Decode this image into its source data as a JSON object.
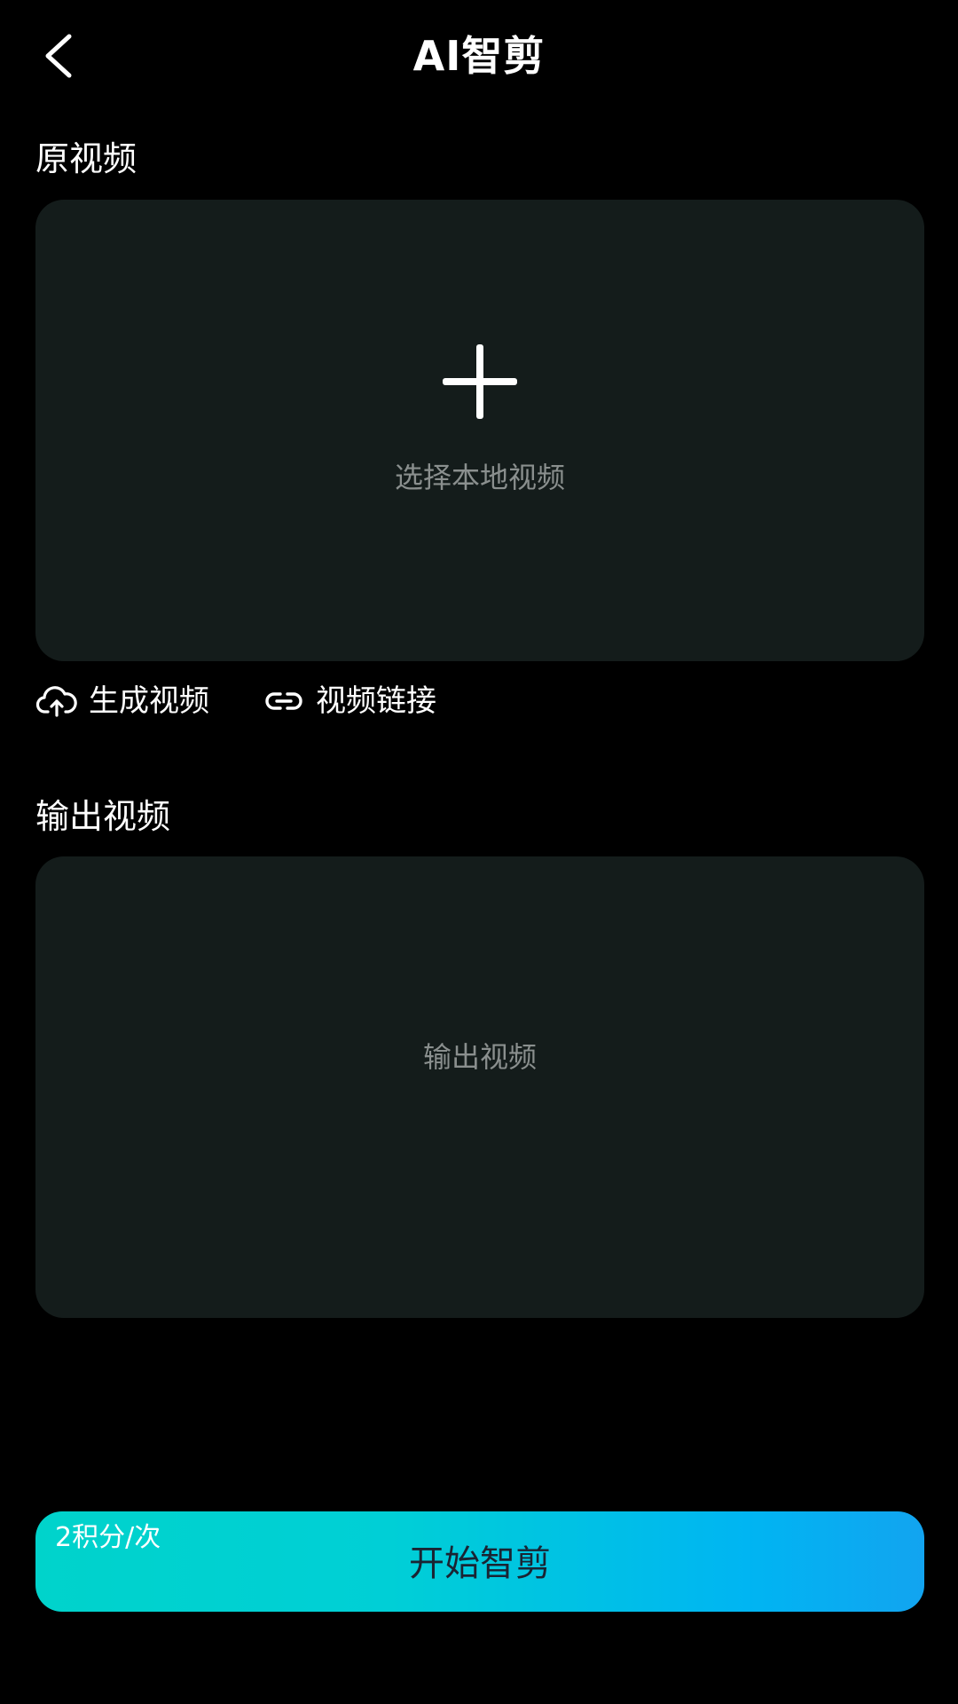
{
  "header": {
    "title": "AI智剪"
  },
  "source": {
    "section_title": "原视频",
    "hint": "选择本地视频"
  },
  "actions": {
    "generate_label": "生成视频",
    "link_label": "视频链接"
  },
  "output": {
    "section_title": "输出视频",
    "hint": "输出视频"
  },
  "start": {
    "cost": "2积分/次",
    "label": "开始智剪"
  },
  "icons": {
    "back": "chevron-left-icon",
    "plus": "plus-icon",
    "upload": "cloud-upload-icon",
    "link": "link-icon"
  },
  "colors": {
    "background": "#000000",
    "panel": "#141c1b",
    "hint_text": "#8a8f8e",
    "button_start": "#00d3cb",
    "button_end": "#12a4f0"
  }
}
